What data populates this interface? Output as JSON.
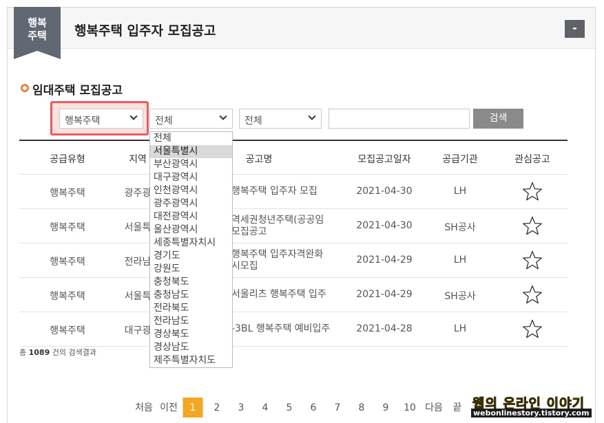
{
  "badge": {
    "line1": "행복",
    "line2": "주택"
  },
  "header": {
    "title": "행복주택 입주자 모집공고",
    "collapse_label": "-"
  },
  "section": {
    "title": "임대주택 모집공고"
  },
  "filters": {
    "type_select": "행복주택",
    "region_select": "전체",
    "sub_select": "전체",
    "search_value": "",
    "search_button": "검색"
  },
  "table": {
    "headers": [
      "공급유형",
      "지역",
      "공고명",
      "모집공고일자",
      "공급기관",
      "관심공고"
    ],
    "rows": [
      {
        "type": "행복주택",
        "region": "광주광",
        "title": "행복주택 입주자 모집",
        "date": "2021-04-30",
        "agency": "LH"
      },
      {
        "type": "행복주택",
        "region": "서울특",
        "title": "역세권청년주택(공공임\n모집공고",
        "date": "2021-04-30",
        "agency": "SH공사"
      },
      {
        "type": "행복주택",
        "region": "전라남",
        "title": "행복주택 입주자격완화\n시모집",
        "date": "2021-04-29",
        "agency": "LH"
      },
      {
        "type": "행복주택",
        "region": "서울특",
        "title": "서울리츠 행복주택 입주",
        "date": "2021-04-29",
        "agency": "SH공사"
      },
      {
        "type": "행복주택",
        "region": "대구광",
        "title": "-3BL 행복주택 예비입주",
        "date": "2021-04-28",
        "agency": "LH"
      }
    ]
  },
  "result": {
    "prefix": "총",
    "count": "1089",
    "suffix": "건의 검색결과"
  },
  "dropdown": {
    "options": [
      "전체",
      "서울특별시",
      "부산광역시",
      "대구광역시",
      "인천광역시",
      "광주광역시",
      "대전광역시",
      "울산광역시",
      "세종특별자치시",
      "경기도",
      "강원도",
      "충청북도",
      "충청남도",
      "전라북도",
      "전라남도",
      "경상북도",
      "경상남도",
      "제주특별자치도"
    ],
    "highlighted": "서울특별시"
  },
  "pagination": {
    "first": "처음",
    "prev": "이전",
    "pages": [
      "1",
      "2",
      "3",
      "4",
      "5",
      "6",
      "7",
      "8",
      "9",
      "10"
    ],
    "current": "1",
    "next": "다음",
    "last": "끝"
  },
  "watermark": {
    "line1": "웹의 온라인 이야기",
    "line2": "webonlinestory.tistory.com"
  },
  "colors": {
    "accent": "#f5a623",
    "ring": "#e9823d",
    "highlight": "#ef5a5a",
    "badge": "#5f6873"
  }
}
